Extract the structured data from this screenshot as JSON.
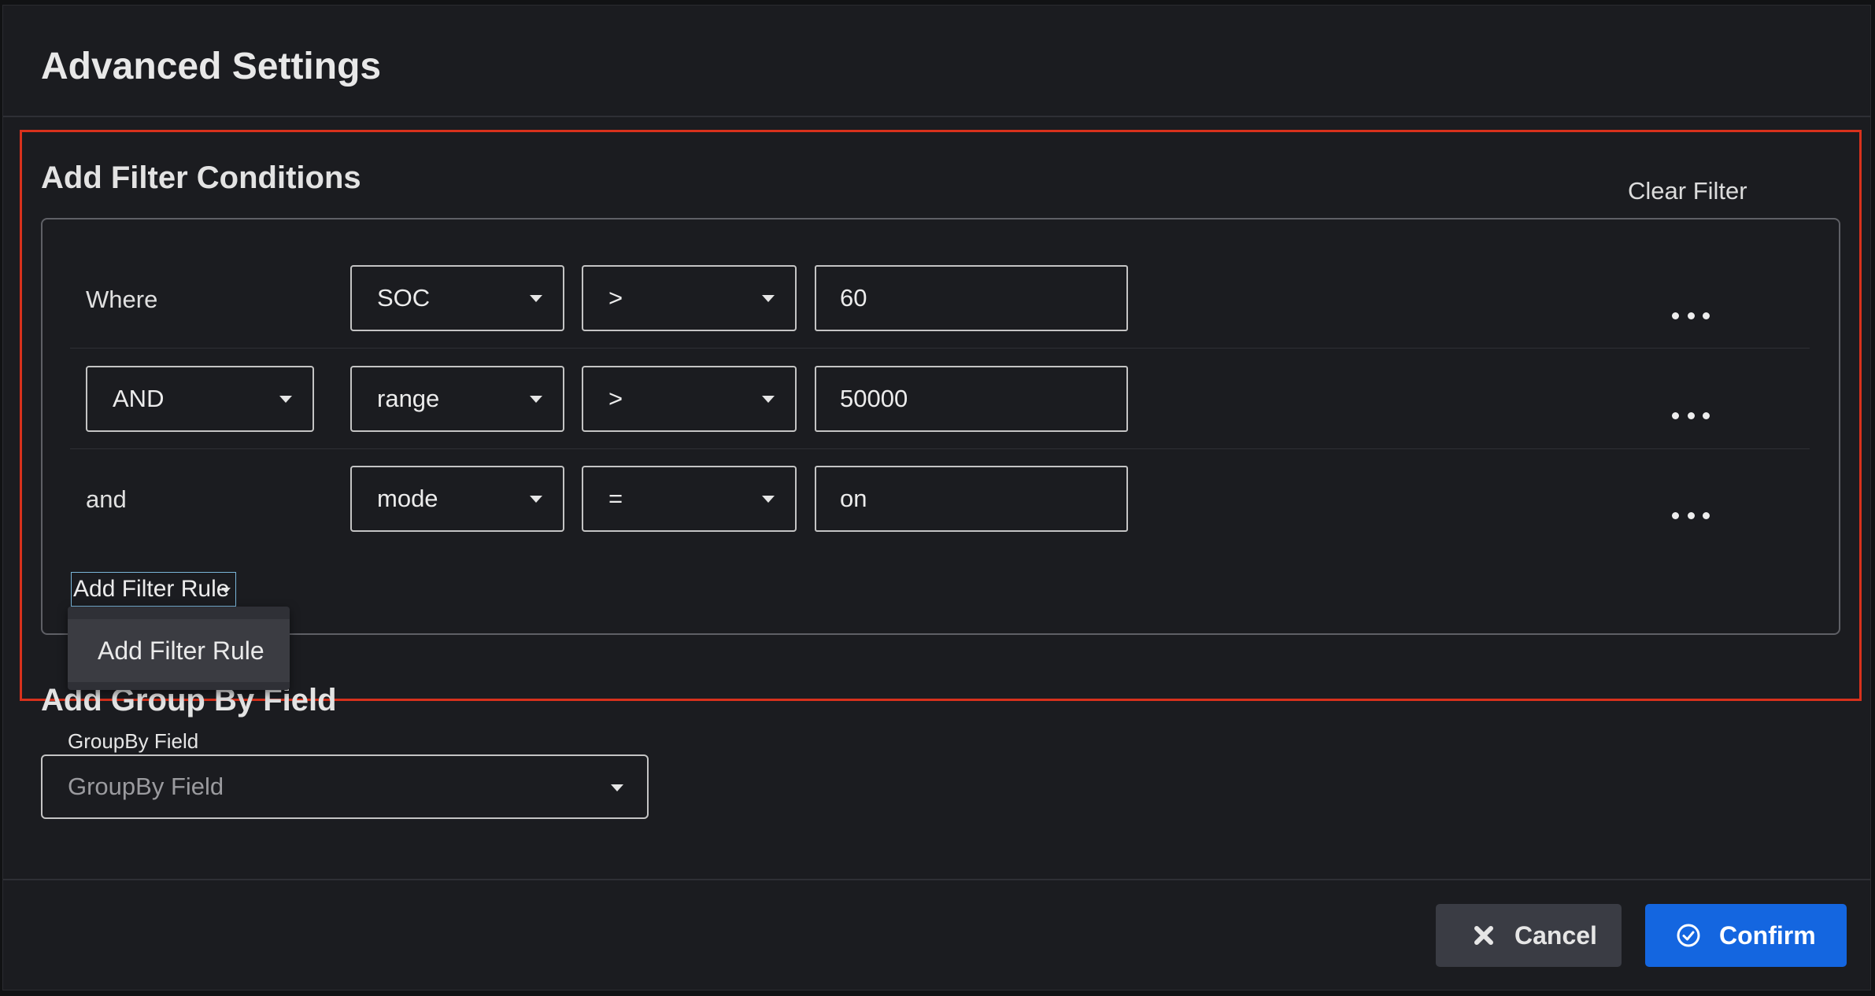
{
  "dialog": {
    "title": "Advanced Settings"
  },
  "filter": {
    "section_title": "Add Filter Conditions",
    "clear_label": "Clear Filter",
    "rules": [
      {
        "connector": "Where",
        "field": "SOC",
        "operator": ">",
        "value": "60"
      },
      {
        "connector": "AND",
        "field": "range",
        "operator": ">",
        "value": "50000"
      },
      {
        "connector": "and",
        "field": "mode",
        "operator": "=",
        "value": "on"
      }
    ],
    "add_rule_label": "Add Filter Rule",
    "menu_items": [
      "Add Filter Rule"
    ]
  },
  "groupby": {
    "section_title": "Add Group By Field",
    "legend": "GroupBy Field",
    "placeholder": "GroupBy Field"
  },
  "footer": {
    "cancel_label": "Cancel",
    "confirm_label": "Confirm"
  },
  "colors": {
    "highlight": "#d8311c",
    "confirm": "#1466e0",
    "cancel": "#3a3c44"
  }
}
